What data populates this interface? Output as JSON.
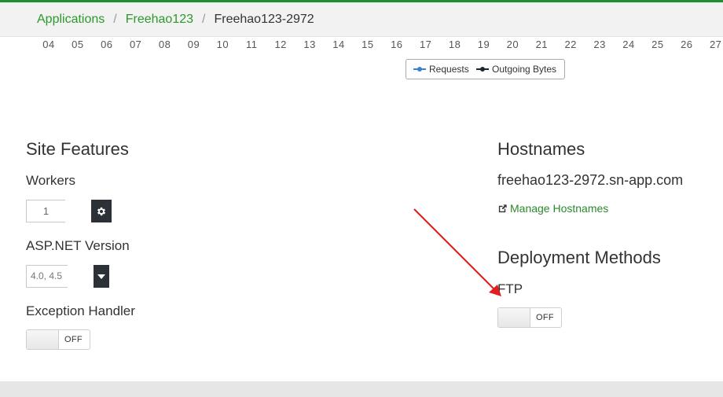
{
  "breadcrumb": {
    "items": [
      "Applications",
      "Freehao123"
    ],
    "current": "Freehao123-2972",
    "separator": "/"
  },
  "chart_axis": {
    "ticks": [
      "04",
      "05",
      "06",
      "07",
      "08",
      "09",
      "10",
      "11",
      "12",
      "13",
      "14",
      "15",
      "16",
      "17",
      "18",
      "19",
      "20",
      "21",
      "22",
      "23",
      "24",
      "25",
      "26",
      "27"
    ]
  },
  "legend": {
    "requests": "Requests",
    "outgoing_bytes": "Outgoing Bytes",
    "requests_color": "#3a7fd1",
    "outgoing_color": "#1b2633"
  },
  "site_features": {
    "title": "Site Features",
    "workers_label": "Workers",
    "workers_value": "1",
    "aspnet_label": "ASP.NET Version",
    "aspnet_value": "4.0, 4.5",
    "exception_label": "Exception Handler",
    "exception_toggle": "OFF"
  },
  "hostnames": {
    "title": "Hostnames",
    "hostname": "freehao123-2972.sn-app.com",
    "manage_link": "Manage Hostnames"
  },
  "deployment": {
    "title": "Deployment Methods",
    "ftp_label": "FTP",
    "ftp_toggle": "OFF"
  },
  "colors": {
    "accent": "#2a9a2a",
    "annotation_arrow": "#e02020"
  }
}
